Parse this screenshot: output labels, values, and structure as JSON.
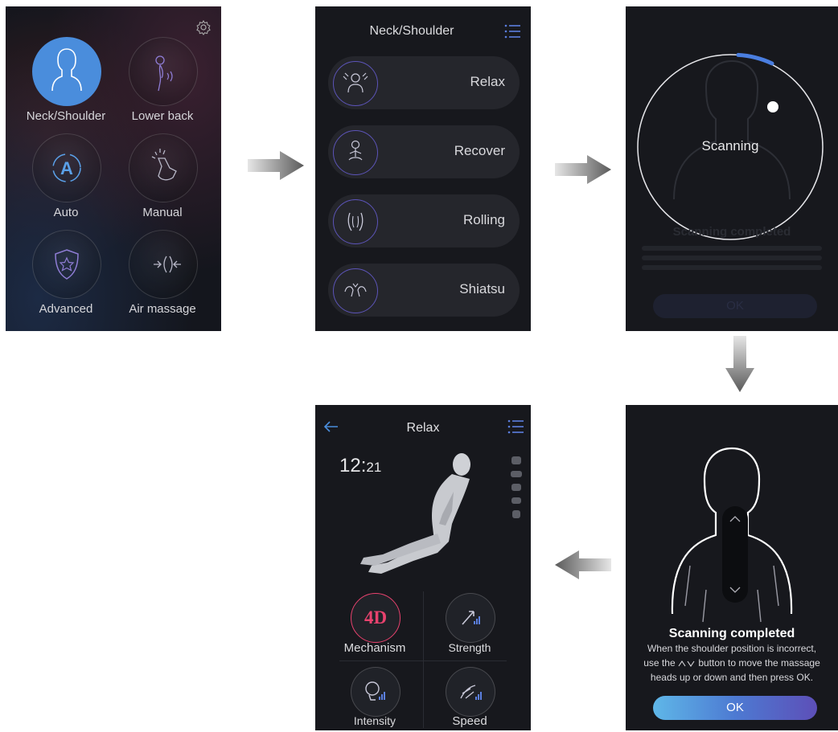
{
  "screen1": {
    "items": [
      {
        "label": "Neck/Shoulder",
        "icon": "neck-shoulder-icon"
      },
      {
        "label": "Lower back",
        "icon": "lower-back-icon"
      },
      {
        "label": "Auto",
        "icon": "auto-icon"
      },
      {
        "label": "Manual",
        "icon": "manual-icon"
      },
      {
        "label": "Advanced",
        "icon": "advanced-shield-icon"
      },
      {
        "label": "Air massage",
        "icon": "air-massage-icon"
      }
    ],
    "auto_letter": "A"
  },
  "screen2": {
    "title": "Neck/Shoulder",
    "programs": [
      {
        "label": "Relax",
        "icon": "relax-icon"
      },
      {
        "label": "Recover",
        "icon": "recover-icon"
      },
      {
        "label": "Rolling",
        "icon": "rolling-icon"
      },
      {
        "label": "Shiatsu",
        "icon": "shiatsu-icon"
      }
    ]
  },
  "screen3": {
    "status": "Scanning",
    "progress": 0.08,
    "faded_title": "Scanning completed",
    "faded_button": "OK"
  },
  "screen4": {
    "title": "Scanning completed",
    "message_line1": "When the shoulder position is incorrect,",
    "message_line2_pre": "use the",
    "message_line2_post": "button to move the massage",
    "message_line3": "heads up or down and then press OK.",
    "ok_label": "OK"
  },
  "screen5": {
    "title": "Relax",
    "time_hours": "12:",
    "time_minutes": "21",
    "mechanism_label": "Mechanism",
    "mechanism_badge": "4D",
    "strength_label": "Strength",
    "intensity_label": "Intensity",
    "speed_label": "Speed"
  },
  "colors": {
    "accent_blue": "#4a8ddc",
    "badge_pink": "#e8426e",
    "panel_bg": "#17181d"
  }
}
